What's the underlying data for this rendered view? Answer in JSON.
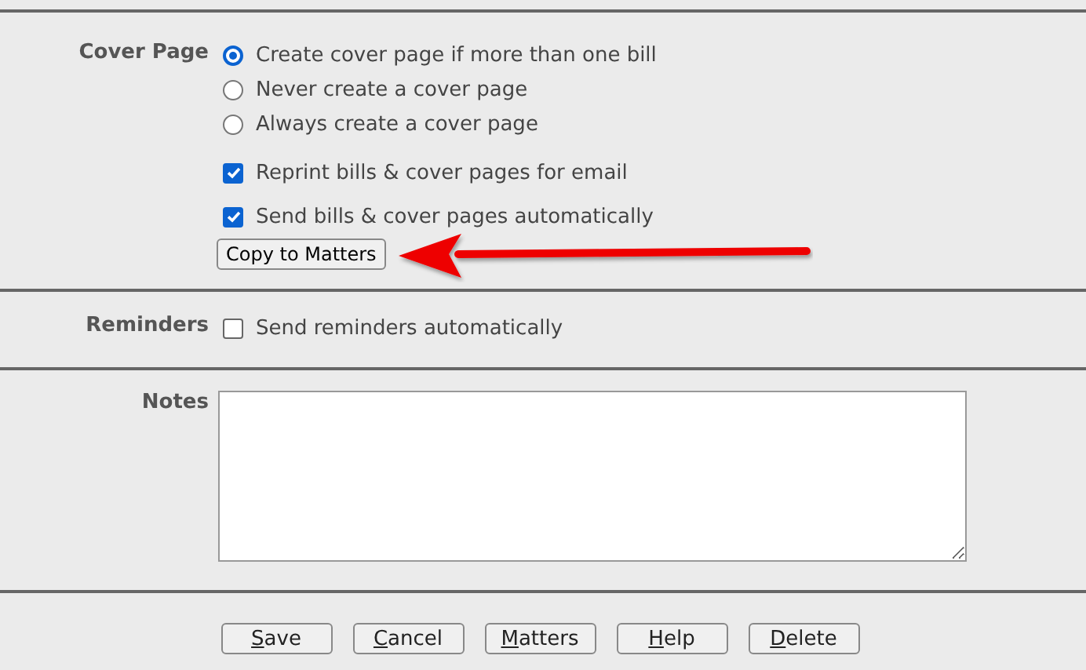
{
  "cover_page": {
    "label": "Cover Page",
    "options": [
      {
        "label": "Create cover page if more than one bill",
        "selected": true
      },
      {
        "label": "Never create a cover page",
        "selected": false
      },
      {
        "label": "Always create a cover page",
        "selected": false
      }
    ],
    "checkboxes": [
      {
        "label": "Reprint bills & cover pages for email",
        "checked": true
      },
      {
        "label": "Send bills & cover pages automatically",
        "checked": true
      }
    ],
    "copy_button": "Copy to Matters"
  },
  "reminders": {
    "label": "Reminders",
    "checkbox": {
      "label": "Send reminders automatically",
      "checked": false
    }
  },
  "notes": {
    "label": "Notes"
  },
  "buttons": [
    {
      "key": "S",
      "rest": "ave"
    },
    {
      "key": "C",
      "rest": "ancel"
    },
    {
      "key": "M",
      "rest": "atters"
    },
    {
      "key": "H",
      "rest": "elp"
    },
    {
      "key": "D",
      "rest": "elete"
    }
  ]
}
